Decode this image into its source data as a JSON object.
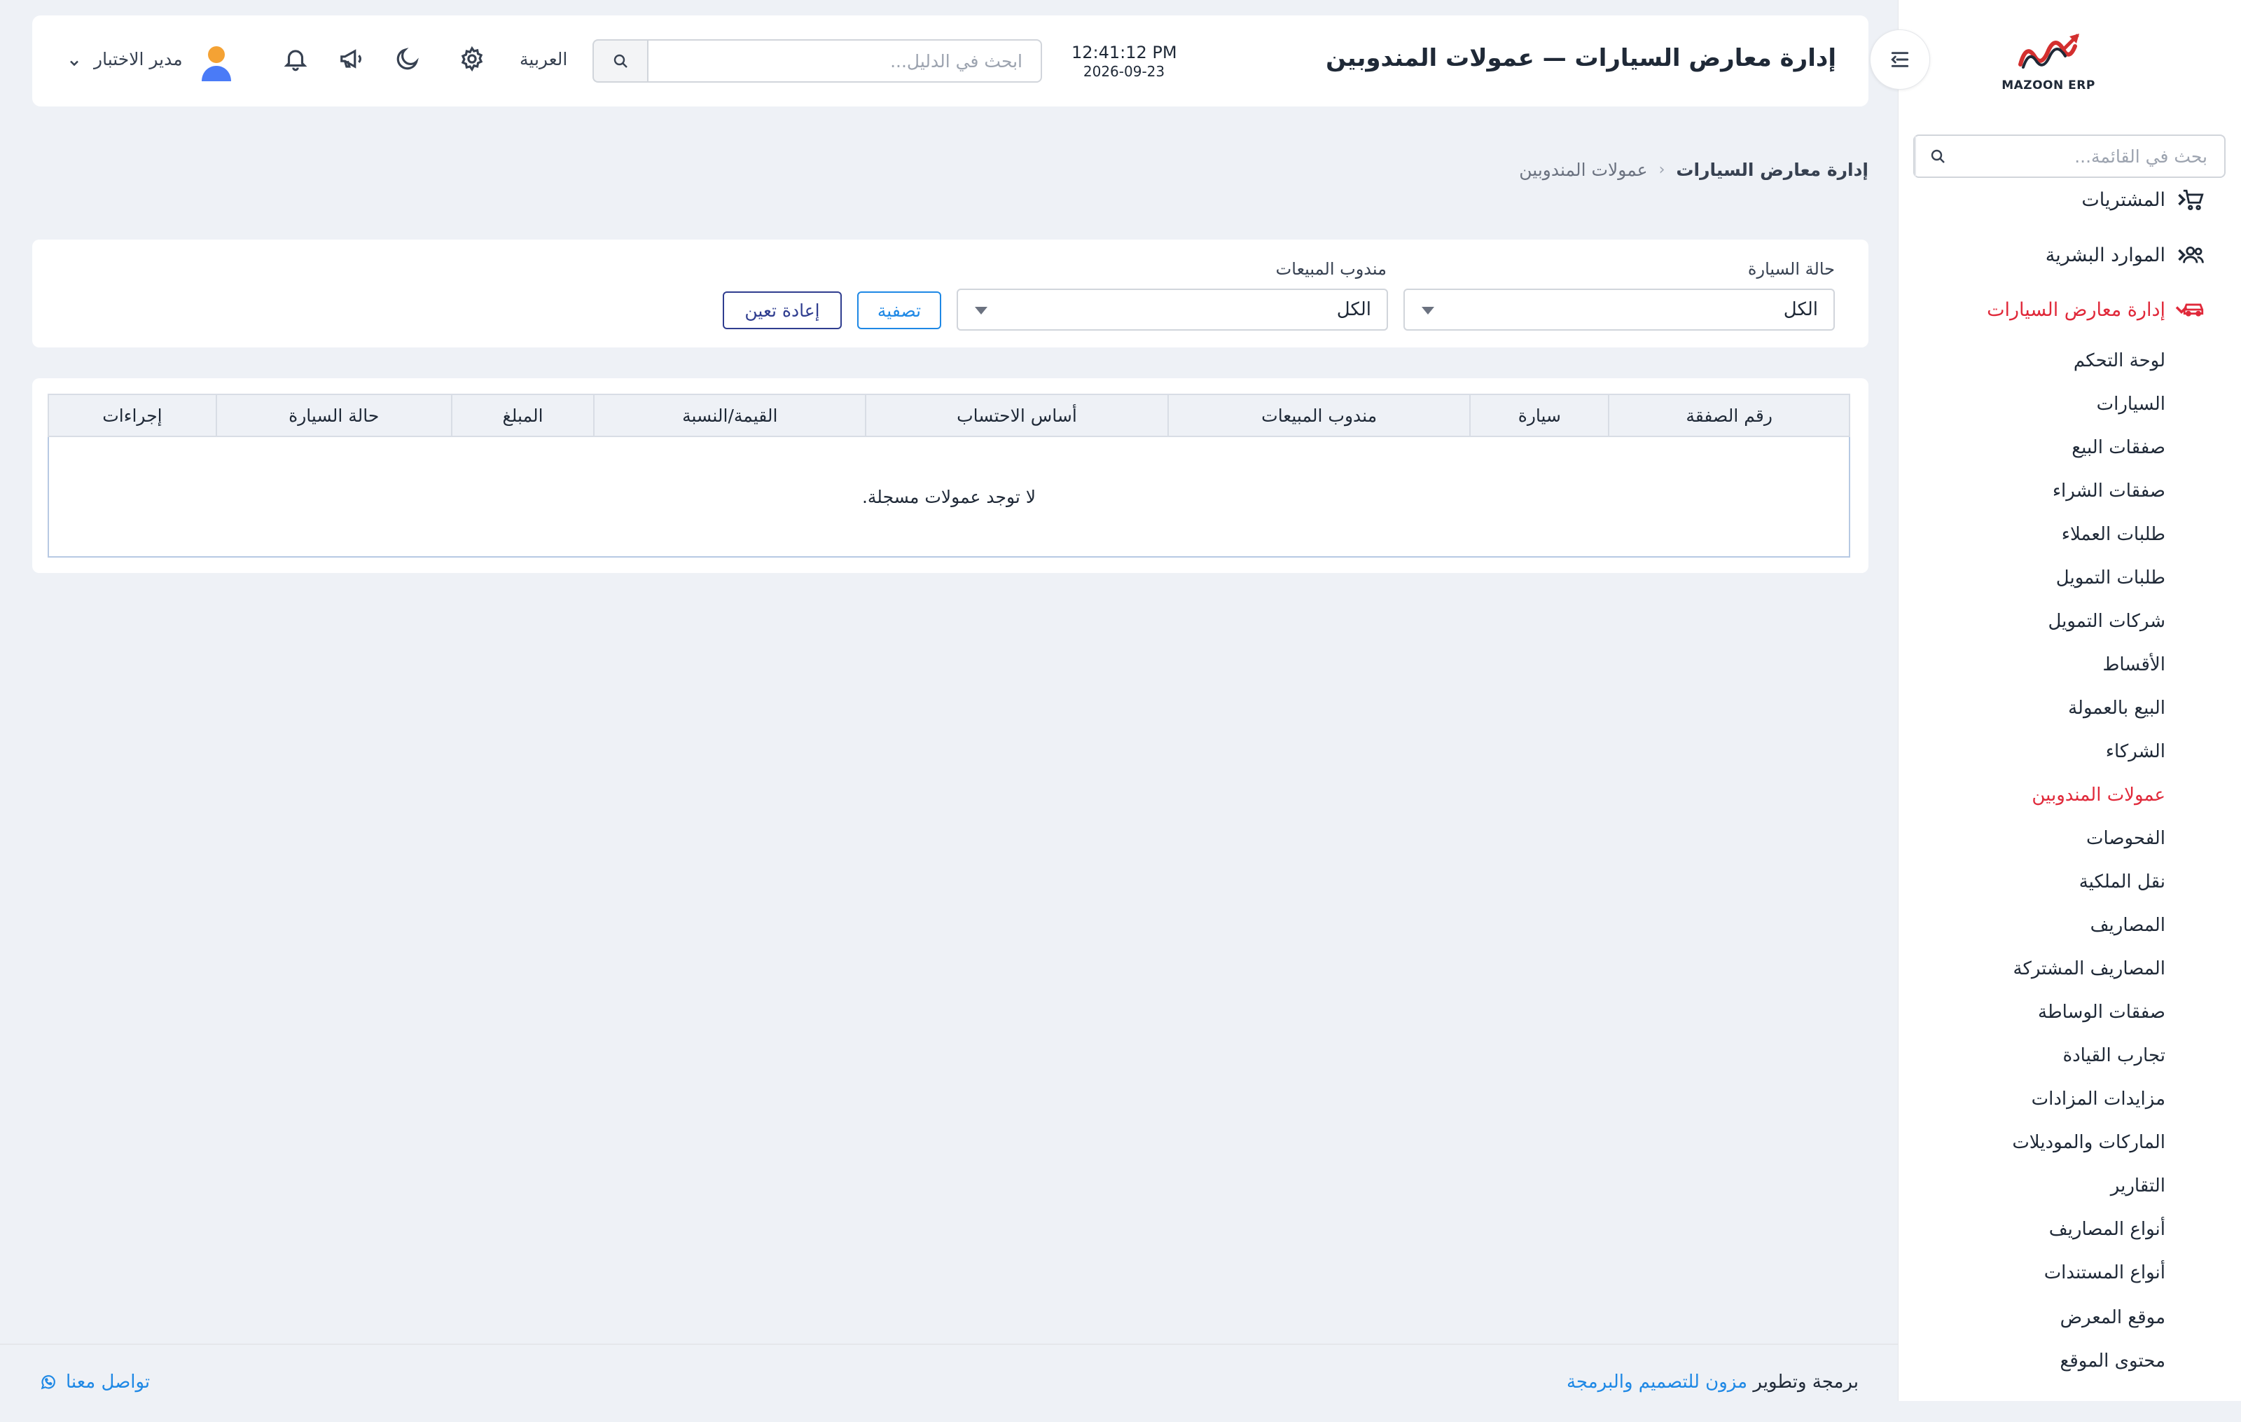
{
  "app": {
    "logo_text": "MAZOON ERP"
  },
  "sidebar": {
    "search_placeholder": "بحث في القائمة...",
    "groups": [
      {
        "label": "المشتريات",
        "icon": "cart-icon"
      },
      {
        "label": "الموارد البشرية",
        "icon": "users-icon"
      },
      {
        "label": "إدارة معارض السيارات",
        "icon": "car-icon"
      }
    ],
    "items": [
      "لوحة التحكم",
      "السيارات",
      "صفقات البيع",
      "صفقات الشراء",
      "طلبات العملاء",
      "طلبات التمويل",
      "شركات التمويل",
      "الأقساط",
      "البيع بالعمولة",
      "الشركاء",
      "عمولات المندوبين",
      "الفحوصات",
      "نقل الملكية",
      "المصاريف",
      "المصاريف المشتركة",
      "صفقات الوساطة",
      "تجارب القيادة",
      "مزايدات المزادات",
      "الماركات والموديلات",
      "التقارير",
      "أنواع المصاريف",
      "أنواع المستندات",
      "موقع المعرض",
      "محتوى الموقع"
    ],
    "active_item": "عمولات المندوبين"
  },
  "header": {
    "title": "إدارة معارض السيارات — عمولات المندوبين",
    "time": "12:41:12 PM",
    "date": "2026-09-23",
    "search_placeholder": "ابحث في الدليل...",
    "language": "العربية",
    "user_name": "مدير الاختبار"
  },
  "breadcrumb": {
    "parent": "إدارة معارض السيارات",
    "current": "عمولات المندوبين"
  },
  "filters": {
    "car_status_label": "حالة السيارة",
    "car_status_value": "الكل",
    "sales_rep_label": "مندوب المبيعات",
    "sales_rep_value": "الكل",
    "filter_button": "تصفية",
    "reset_button": "إعادة تعين"
  },
  "table": {
    "columns": [
      "رقم الصفقة",
      "سيارة",
      "مندوب المبيعات",
      "أساس الاحتساب",
      "القيمة/النسبة",
      "المبلغ",
      "حالة السيارة",
      "إجراءات"
    ],
    "empty_message": "لا توجد عمولات مسجلة."
  },
  "footer": {
    "credit_prefix": "برمجة وتطوير",
    "credit_link": "مزون للتصميم والبرمجة",
    "contact": "تواصل معنا"
  },
  "colors": {
    "accent_red": "#e0293a",
    "link_blue": "#1e88e5",
    "reset_navy": "#2f3d8f",
    "background": "#eef1f6"
  }
}
